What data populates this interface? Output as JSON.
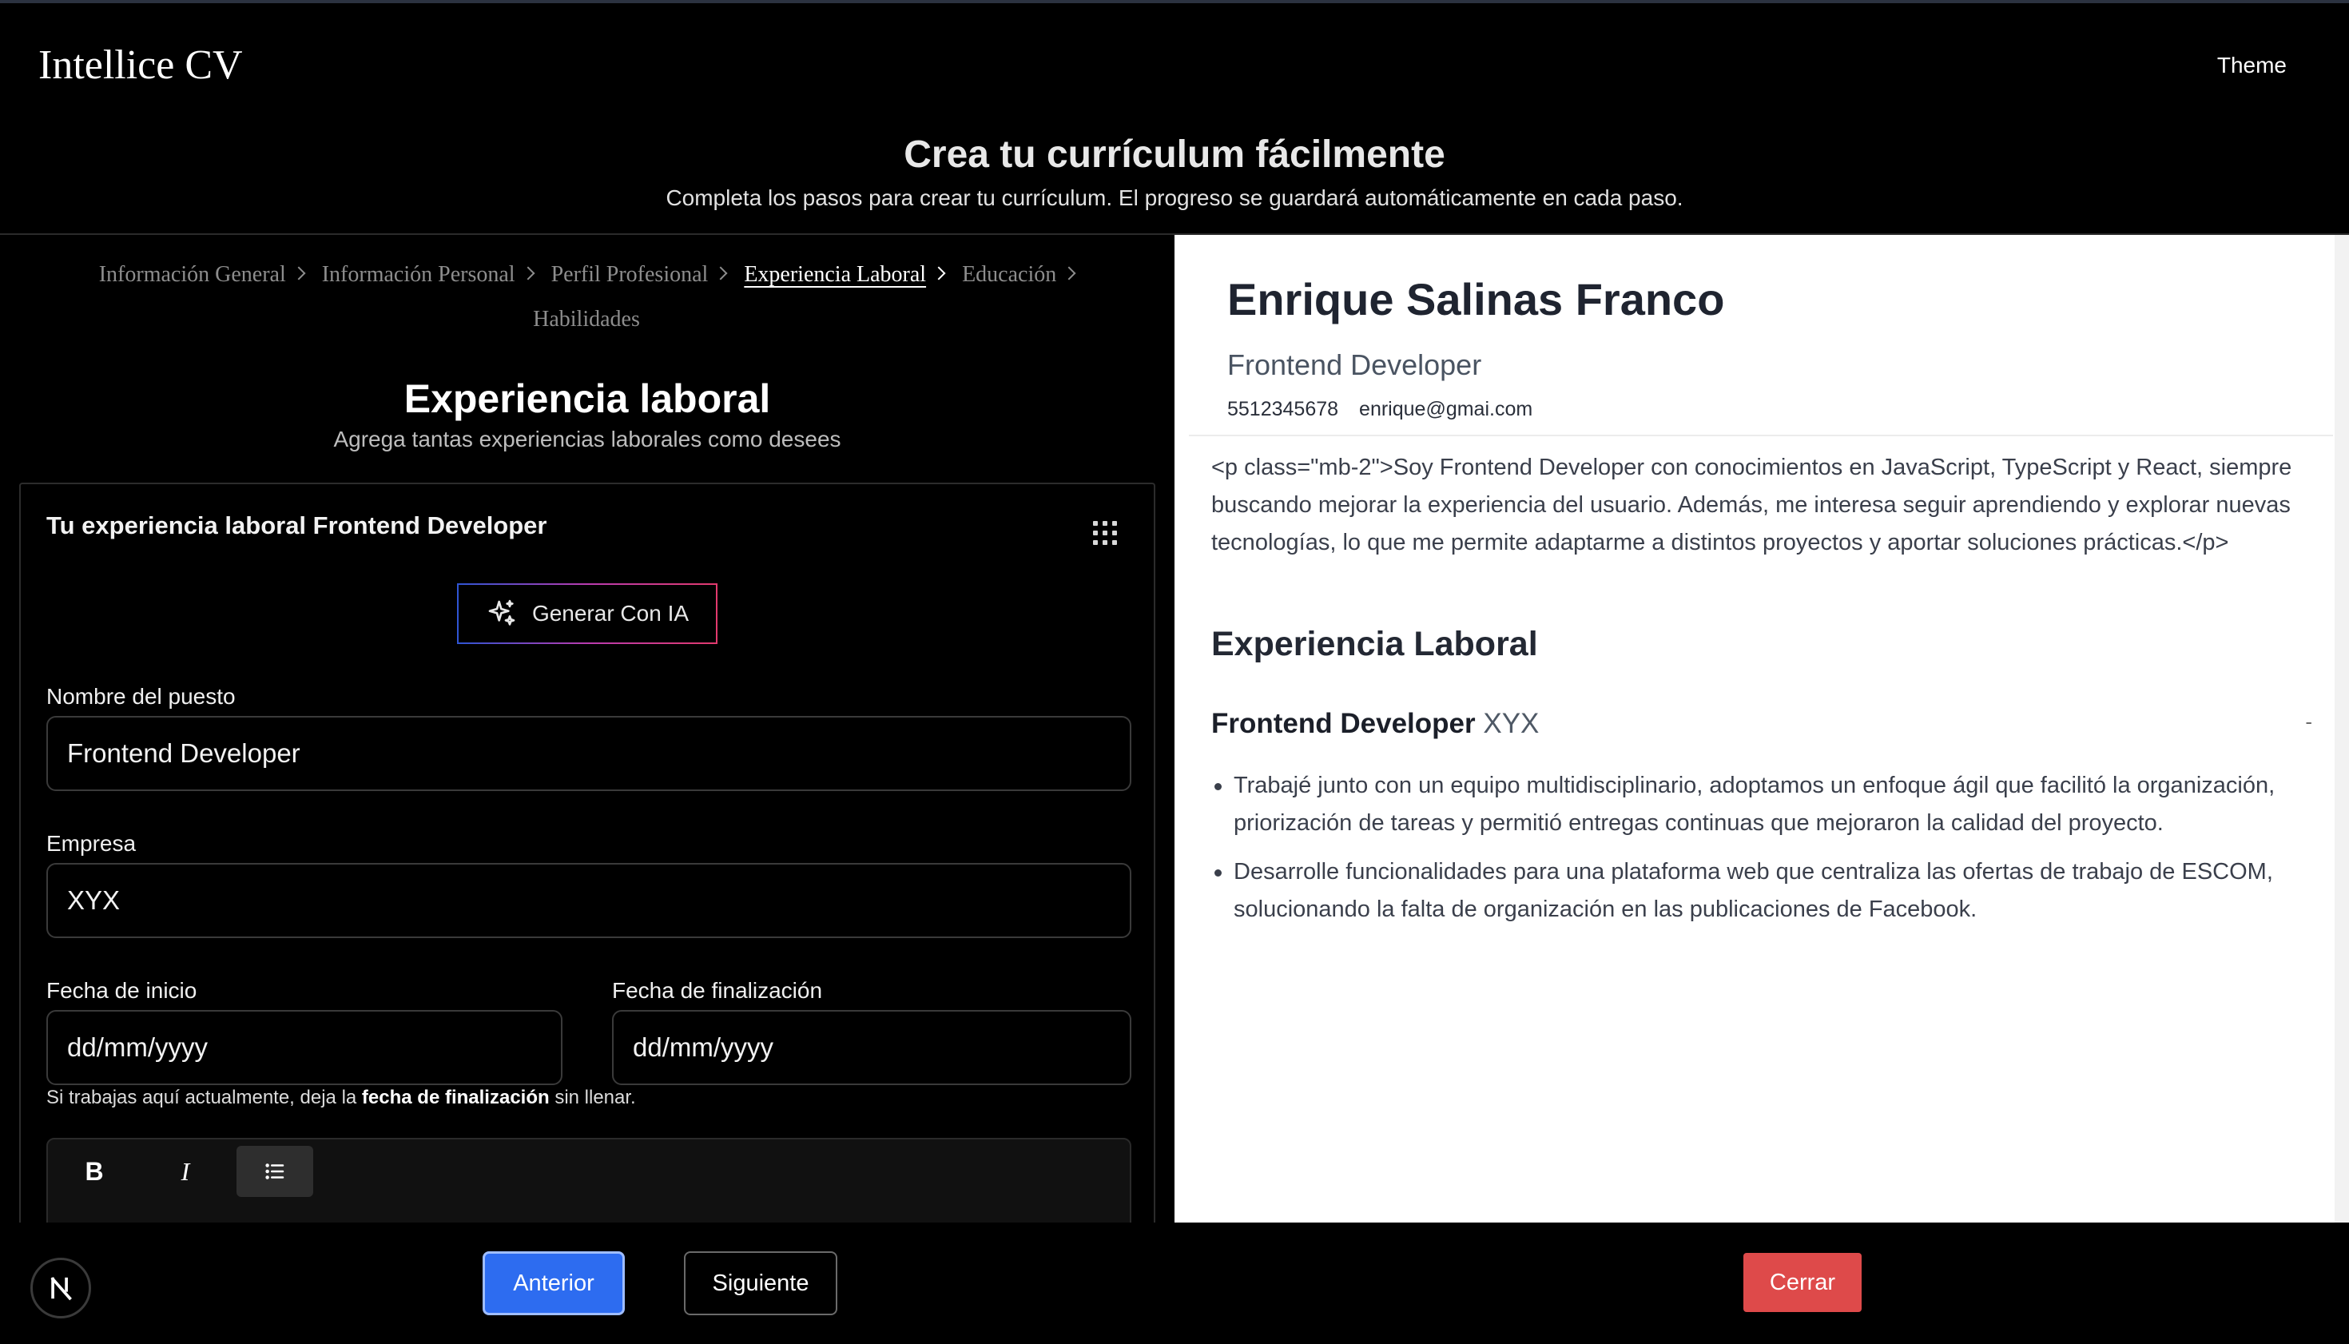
{
  "app": {
    "brand": "Intellice CV",
    "theme_label": "Theme"
  },
  "hero": {
    "title": "Crea tu currículum fácilmente",
    "subtitle": "Completa los pasos para crear tu currículum. El progreso se guardará automáticamente en cada paso."
  },
  "breadcrumb": {
    "items": [
      {
        "label": "Información General",
        "active": false
      },
      {
        "label": "Información Personal",
        "active": false
      },
      {
        "label": "Perfil Profesional",
        "active": false
      },
      {
        "label": "Experiencia Laboral",
        "active": true
      },
      {
        "label": "Educación",
        "active": false
      },
      {
        "label": "Habilidades",
        "active": false
      }
    ]
  },
  "section": {
    "title": "Experiencia laboral",
    "subtitle": "Agrega tantas experiencias laborales como desees"
  },
  "card": {
    "title": "Tu experiencia laboral Frontend Developer",
    "ai_button": "Generar Con IA",
    "job_title_label": "Nombre del puesto",
    "job_title_value": "Frontend Developer",
    "company_label": "Empresa",
    "company_value": "XYX",
    "start_label": "Fecha de inicio",
    "start_placeholder": "dd/mm/yyyy",
    "end_label": "Fecha de finalización",
    "end_placeholder": "dd/mm/yyyy",
    "hint_prefix": "Si trabajas aquí actualmente, deja la ",
    "hint_bold": "fecha de finalización",
    "hint_suffix": " sin llenar.",
    "editor_tools": {
      "bold": "B",
      "italic": "I"
    }
  },
  "preview": {
    "name": "Enrique Salinas Franco",
    "role": "Frontend Developer",
    "phone": "5512345678",
    "email": "enrique@gmai.com",
    "summary": "<p class=\"mb-2\">Soy Frontend Developer con conocimientos en JavaScript, TypeScript y React, siempre buscando mejorar la experiencia del usuario. Además, me interesa seguir aprendiendo y explorar nuevas tecnologías, lo que me permite adaptarme a distintos proyectos y aportar soluciones prácticas.</p>",
    "section_title": "Experiencia Laboral",
    "job_title": "Frontend Developer",
    "job_company": "XYX",
    "job_dates": "-",
    "bullets": [
      "Trabajé junto con un equipo multidisciplinario, adoptamos un enfoque ágil que facilitó la organización, priorización de tareas y permitió entregas continuas que mejoraron la calidad del proyecto.",
      "Desarrolle funcionalidades para una plataforma web que centraliza las ofertas de trabajo de ESCOM, solucionando la falta de organización en las publicaciones de Facebook."
    ]
  },
  "footer": {
    "prev_label": "Anterior",
    "next_label": "Siguiente",
    "close_label": "Cerrar",
    "logo_letter": "N"
  },
  "colors": {
    "primary_button": "#2d6cf0",
    "danger_button": "#de4a4a",
    "ai_gradient": [
      "#2f55d4",
      "#b93cb0",
      "#e23a6d"
    ]
  },
  "icons": [
    "sparkles-icon",
    "grip-dots-icon",
    "bold-icon",
    "italic-icon",
    "list-icon",
    "chevron-right-icon",
    "nextjs-logo-icon"
  ]
}
